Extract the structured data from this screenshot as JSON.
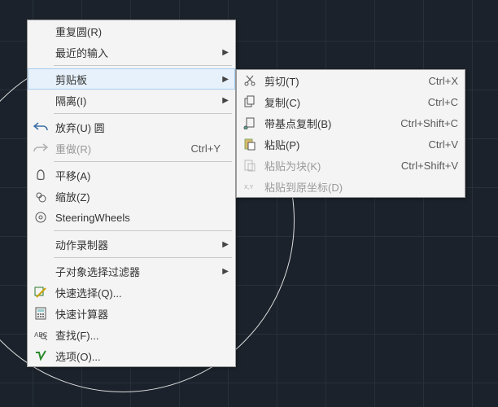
{
  "main_menu": {
    "items": [
      {
        "label": "重复圆(R)"
      },
      {
        "label": "最近的输入",
        "submenu": true
      },
      {
        "label": "剪贴板",
        "submenu": true,
        "hover": true
      },
      {
        "label": "隔离(I)",
        "submenu": true
      },
      {
        "label": "放弃(U) 圆"
      },
      {
        "label": "重做(R)",
        "shortcut": "Ctrl+Y",
        "disabled": true
      },
      {
        "label": "平移(A)"
      },
      {
        "label": "缩放(Z)"
      },
      {
        "label": "SteeringWheels"
      },
      {
        "label": "动作录制器",
        "submenu": true
      },
      {
        "label": "子对象选择过滤器",
        "submenu": true
      },
      {
        "label": "快速选择(Q)..."
      },
      {
        "label": "快速计算器"
      },
      {
        "label": "查找(F)..."
      },
      {
        "label": "选项(O)..."
      }
    ]
  },
  "sub_menu": {
    "items": [
      {
        "label": "剪切(T)",
        "shortcut": "Ctrl+X"
      },
      {
        "label": "复制(C)",
        "shortcut": "Ctrl+C"
      },
      {
        "label": "带基点复制(B)",
        "shortcut": "Ctrl+Shift+C"
      },
      {
        "label": "粘贴(P)",
        "shortcut": "Ctrl+V"
      },
      {
        "label": "粘贴为块(K)",
        "shortcut": "Ctrl+Shift+V",
        "disabled": true
      },
      {
        "label": "粘贴到原坐标(D)",
        "disabled": true
      }
    ]
  }
}
